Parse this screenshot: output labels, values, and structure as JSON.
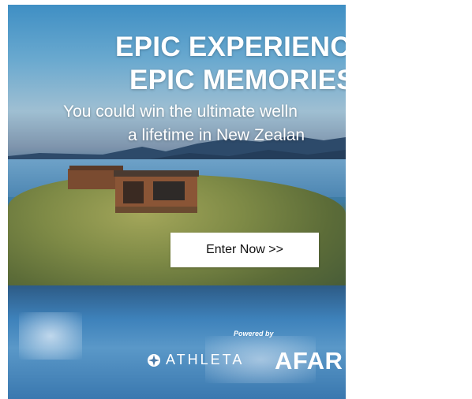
{
  "ad": {
    "headline_line1": "EPIC EXPERIENCE",
    "headline_line2": "EPIC MEMORIES",
    "subline1": "You could win the ultimate welln",
    "subline2": "a lifetime in New Zealan",
    "cta_label": "Enter Now >>",
    "powered_by": "Powered by",
    "sponsor1": "ATHLETA",
    "sponsor2": "AFAR"
  },
  "colors": {
    "sky": "#6aa9cf",
    "lake": "#3d7ab0",
    "cta_background": "#ffffff",
    "text": "#ffffff"
  },
  "icons": [
    "athleta-logo-icon"
  ]
}
